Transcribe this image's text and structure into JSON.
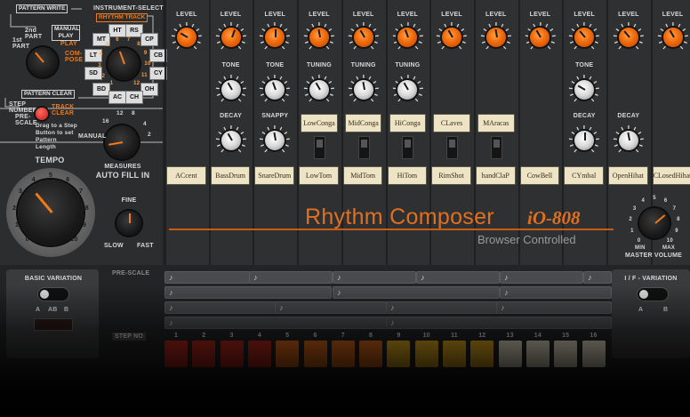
{
  "left": {
    "pattern_write": "PATTERN WRITE",
    "instrument_select": "INSTRUMENT-SELECT",
    "rhythm_track": "RHYTHM TRACK",
    "part_1st": "1st PART",
    "part_2nd": "2nd PART",
    "manual_play": "MANUAL PLAY",
    "play": "PLAY",
    "compose": "COM-POSE",
    "pattern_clear": "PATTERN CLEAR",
    "step_number": "STEP NUMBER",
    "pre_scale": "PRE-SCALE",
    "track_clear": "TRACK CLEAR",
    "drag_hint": "Drag to a Step Button to set Pattern Length",
    "inst_buttons": [
      "HT",
      "RS",
      "MT",
      "CP",
      "LT",
      "CB",
      "SD",
      "CY",
      "BD",
      "OH",
      "AC",
      "CH"
    ],
    "dial_numbers": [
      "1",
      "2",
      "3",
      "4",
      "5",
      "6",
      "7",
      "8",
      "9",
      "10",
      "11",
      "12"
    ],
    "autofill_numbers": [
      "12",
      "8",
      "4",
      "2",
      "16"
    ],
    "manual": "MANUAL",
    "measures": "MEASURES",
    "auto_fill_in": "AUTO FILL IN",
    "tempo": "TEMPO",
    "tempo_numbers": [
      "0",
      "1",
      "2",
      "3",
      "4",
      "5",
      "6",
      "7",
      "8",
      "9",
      "10"
    ],
    "fine": "FINE",
    "slow": "SLOW",
    "fast": "FAST"
  },
  "channels": [
    {
      "level": "LEVEL",
      "row2": "",
      "row3": "",
      "button": "ACcent",
      "mid": ""
    },
    {
      "level": "LEVEL",
      "row2": "TONE",
      "row3": "DECAY",
      "button": "BassDrum",
      "mid": ""
    },
    {
      "level": "LEVEL",
      "row2": "TONE",
      "row3": "SNAPPY",
      "button": "SnareDrum",
      "mid": ""
    },
    {
      "level": "LEVEL",
      "row2": "TUNING",
      "row3": "",
      "button": "LowTom",
      "mid": "LowConga"
    },
    {
      "level": "LEVEL",
      "row2": "TUNING",
      "row3": "",
      "button": "MidTom",
      "mid": "MidConga"
    },
    {
      "level": "LEVEL",
      "row2": "TUNING",
      "row3": "",
      "button": "HiTom",
      "mid": "HiConga"
    },
    {
      "level": "LEVEL",
      "row2": "",
      "row3": "",
      "button": "RimShot",
      "mid": "CLaves"
    },
    {
      "level": "LEVEL",
      "row2": "",
      "row3": "",
      "button": "handClaP",
      "mid": "MAracas"
    },
    {
      "level": "LEVEL",
      "row2": "",
      "row3": "",
      "button": "CowBell",
      "mid": ""
    },
    {
      "level": "LEVEL",
      "row2": "TONE",
      "row3": "DECAY",
      "button": "CYmbal",
      "mid": ""
    },
    {
      "level": "LEVEL",
      "row2": "",
      "row3": "DECAY",
      "button": "OpenHihat",
      "mid": ""
    },
    {
      "level": "LEVEL",
      "row2": "",
      "row3": "",
      "button": "CLosedHihat",
      "mid": ""
    }
  ],
  "brand": {
    "title": "Rhythm Composer",
    "model": "iO-808",
    "subtitle": "Browser Controlled"
  },
  "master": {
    "label": "MASTER VOLUME",
    "min": "MIN",
    "max": "MAX",
    "numbers": [
      "0",
      "1",
      "2",
      "3",
      "4",
      "5",
      "6",
      "7",
      "8",
      "9",
      "10"
    ]
  },
  "bottom": {
    "basic_variation": "BASIC VARIATION",
    "a": "A",
    "ab": "AB",
    "b": "B",
    "pre_scale": "PRE-SCALE",
    "if_variation": "I / F - VARIATION",
    "if_a": "A",
    "if_b": "B",
    "step_no": "STEP NO",
    "steps": [
      "1",
      "2",
      "3",
      "4",
      "5",
      "6",
      "7",
      "8",
      "9",
      "10",
      "11",
      "12",
      "13",
      "14",
      "15",
      "16"
    ],
    "step_colors": [
      "#c0281e",
      "#c0281e",
      "#c0281e",
      "#c0281e",
      "#e06a1a",
      "#e06a1a",
      "#e06a1a",
      "#e06a1a",
      "#e8b020",
      "#e8b020",
      "#e8b020",
      "#e8b020",
      "#e8e2c8",
      "#e8e2c8",
      "#e8e2c8",
      "#e8e2c8"
    ]
  }
}
